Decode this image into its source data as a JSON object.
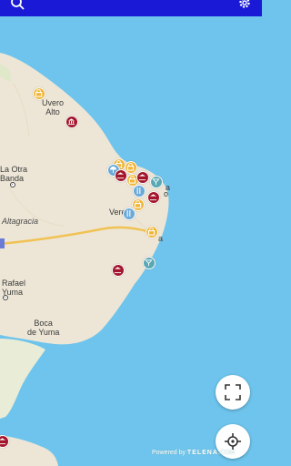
{
  "header": {
    "search_icon": "search-icon",
    "settings_icon": "gear-icon",
    "background": "#1a1ad6"
  },
  "map": {
    "colors": {
      "water": "#6ec4ec",
      "land": "#ede6d6",
      "road": "#f1c253"
    },
    "places": {
      "uvero_alto": "Uvero\nAlto",
      "la_otra_banda": "La Otra\nBanda",
      "altagracia": "Altagracia",
      "vere": "Vere",
      "rafael_yuma": "Rafael\nYuma",
      "boca_de_yuma": "Boca\nde Yuma",
      "punta_cana_1": "a",
      "punta_cana_2": "o",
      "cap_cana": "a"
    },
    "markers": [
      {
        "type": "shopping",
        "color": "yellow"
      },
      {
        "type": "museum",
        "color": "red"
      },
      {
        "type": "shopping",
        "color": "yellow"
      },
      {
        "type": "shopping",
        "color": "yellow"
      },
      {
        "type": "shopping",
        "color": "yellow"
      },
      {
        "type": "beach",
        "color": "blue"
      },
      {
        "type": "museum",
        "color": "red"
      },
      {
        "type": "shopping",
        "color": "yellow"
      },
      {
        "type": "museum",
        "color": "red"
      },
      {
        "type": "nightlife",
        "color": "teal"
      },
      {
        "type": "restaurant",
        "color": "blue"
      },
      {
        "type": "museum",
        "color": "red"
      },
      {
        "type": "shopping",
        "color": "yellow"
      },
      {
        "type": "restaurant",
        "color": "blue"
      },
      {
        "type": "shopping",
        "color": "yellow"
      },
      {
        "type": "museum",
        "color": "red"
      },
      {
        "type": "nightlife",
        "color": "teal"
      },
      {
        "type": "museum",
        "color": "red"
      }
    ]
  },
  "controls": {
    "fullscreen_icon": "fullscreen-icon",
    "locate_icon": "locate-icon"
  },
  "credit": {
    "prefix": "Powered by",
    "brand": "TELENA",
    "suffix": ".COM"
  }
}
